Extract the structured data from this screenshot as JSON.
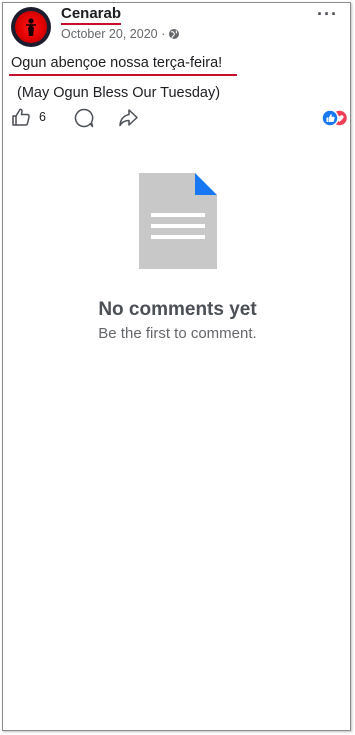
{
  "post": {
    "author": "Cenarab",
    "date": "October 20, 2020 ·",
    "text": "Ogun abençoe nossa terça-feira!",
    "translation": "(May Ogun Bless Our Tuesday)",
    "more_label": "···"
  },
  "actions": {
    "like_count": "6"
  },
  "empty": {
    "title": "No comments yet",
    "subtitle": "Be the first to comment."
  },
  "colors": {
    "annotation_red": "#c8102e",
    "like_blue": "#1877f2",
    "love_red": "#f33e58",
    "doc_gray": "#c8c8c8",
    "doc_fold": "#1877f2"
  }
}
